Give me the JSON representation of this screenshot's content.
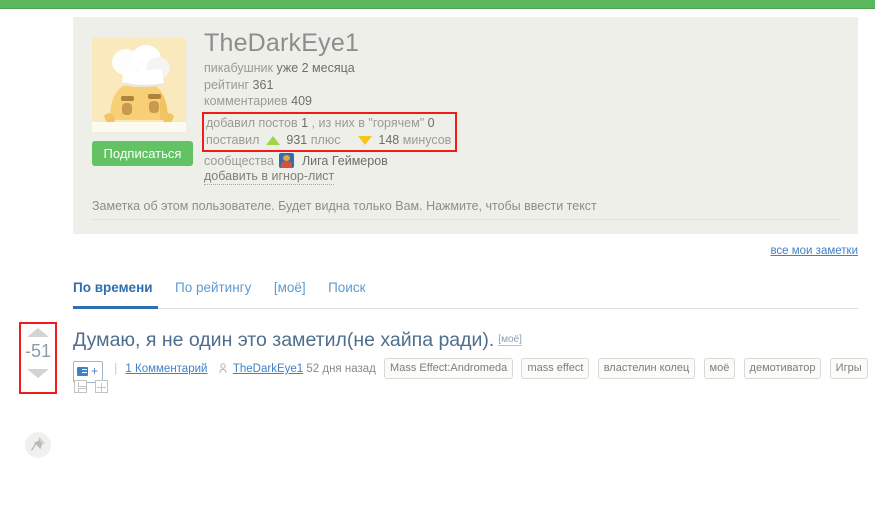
{
  "theme": {
    "header_green": "#5cb85c",
    "card_bg": "#eeefe9",
    "highlight_red": "#f01c1c",
    "link_blue": "#3f82c6",
    "accent_blue": "#2f6fad",
    "subscribe_green": "#63c263",
    "plus_green": "#9ed648",
    "minus_yellow": "#f5c518"
  },
  "profile": {
    "username": "TheDarkEye1",
    "status_label": "пикабушник",
    "status_value": "уже 2 месяца",
    "rating_label": "рейтинг",
    "rating_value": "361",
    "comments_label": "комментариев",
    "comments_value": "409",
    "posts_label": "добавил постов",
    "posts_value": "1",
    "posts_hot_label": ", из них в \"горячем\"",
    "posts_hot_value": "0",
    "voted_label": "поставил",
    "plus_value": "931",
    "plus_unit": "плюс",
    "minus_value": "148",
    "minus_unit": "минусов",
    "communities_label": "сообщества",
    "community_name": "Лига Геймеров",
    "subscribe_label": "Подписаться",
    "ignore_label": "добавить в игнор-лист",
    "avatar_icon": "pikabu-mascot-avatar",
    "community_icon": "community-avatar-icon"
  },
  "note": {
    "placeholder": "Заметка об этом пользователе. Будет видна только Вам. Нажмите, чтобы ввести текст",
    "all_notes_label": "все мои заметки"
  },
  "tabs": [
    {
      "label": "По времени",
      "active": true
    },
    {
      "label": "По рейтингу",
      "active": false
    },
    {
      "label": "[моё]",
      "active": false
    },
    {
      "label": "Поиск",
      "active": false
    }
  ],
  "post": {
    "vote_count": "-51",
    "upvote_icon": "arrow-up-icon",
    "downvote_icon": "arrow-down-icon",
    "title": "Думаю, я не один это заметил(не хайпа ради).",
    "mine_badge": "[моё]",
    "expand_icon": "expand-post-icon",
    "expand_plus": "+",
    "comments_label": "1 Комментарий",
    "author_icon": "user-icon",
    "author": "TheDarkEye1",
    "time_ago": "52 дня назад",
    "tags": [
      "Mass Effect:Andromeda",
      "mass effect",
      "властелин колец",
      "моё",
      "демотиватор",
      "Игры"
    ],
    "save_icon": "save-icon",
    "add_icon": "add-to-collection-icon"
  },
  "pin": {
    "icon": "pin-icon"
  }
}
